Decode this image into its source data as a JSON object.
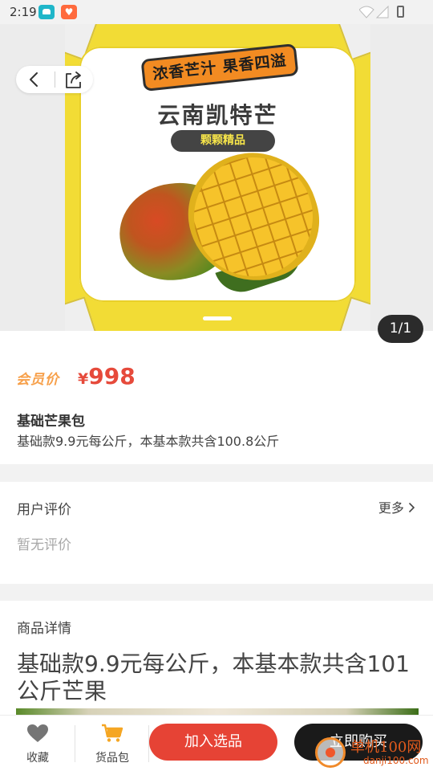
{
  "status_bar": {
    "time": "2:19"
  },
  "gallery": {
    "poster_ribbon": "浓香芒汁 果香四溢",
    "poster_headline": "云南凯特芒",
    "poster_badge": "颗颗精品",
    "counter": "1/1"
  },
  "product": {
    "member_tag": "会员价",
    "currency": "¥",
    "price": "998",
    "name": "基础芒果包",
    "description": "基础款9.9元每公斤，本基本款共含100.8公斤"
  },
  "reviews": {
    "title": "用户评价",
    "more": "更多",
    "empty": "暂无评价"
  },
  "detail": {
    "title": "商品详情",
    "text": "基础款9.9元每公斤，本基本款共含101公斤芒果"
  },
  "bottom_bar": {
    "favorite": "收藏",
    "package": "货品包",
    "add": "加入选品",
    "buy": "立即购买"
  },
  "watermark": {
    "line1": "单机100网",
    "line2": "danji100.com"
  },
  "colors": {
    "price_red": "#e64a3b",
    "add_button": "#e64335",
    "buy_button": "#1a1a1a",
    "member_orange": "#f7a04a",
    "cart_yellow": "#f5a623"
  }
}
